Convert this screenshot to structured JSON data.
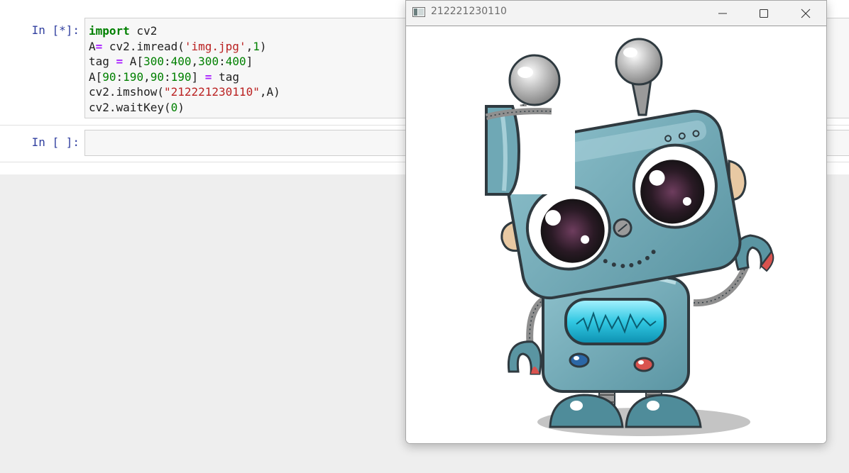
{
  "notebook": {
    "cells": [
      {
        "prompt": "In [*]:",
        "lines": [
          [
            {
              "t": "import",
              "c": "kw"
            },
            {
              "t": " cv2",
              "c": ""
            }
          ],
          [
            {
              "t": "A",
              "c": ""
            },
            {
              "t": "=",
              "c": "op"
            },
            {
              "t": " cv2.imread(",
              "c": ""
            },
            {
              "t": "'img.jpg'",
              "c": "str"
            },
            {
              "t": ",",
              "c": ""
            },
            {
              "t": "1",
              "c": "num"
            },
            {
              "t": ")",
              "c": ""
            }
          ],
          [
            {
              "t": "tag ",
              "c": ""
            },
            {
              "t": "=",
              "c": "op"
            },
            {
              "t": " A[",
              "c": ""
            },
            {
              "t": "300",
              "c": "num"
            },
            {
              "t": ":",
              "c": ""
            },
            {
              "t": "400",
              "c": "num"
            },
            {
              "t": ",",
              "c": ""
            },
            {
              "t": "300",
              "c": "num"
            },
            {
              "t": ":",
              "c": ""
            },
            {
              "t": "400",
              "c": "num"
            },
            {
              "t": "]",
              "c": ""
            }
          ],
          [
            {
              "t": "A[",
              "c": ""
            },
            {
              "t": "90",
              "c": "num"
            },
            {
              "t": ":",
              "c": ""
            },
            {
              "t": "190",
              "c": "num"
            },
            {
              "t": ",",
              "c": ""
            },
            {
              "t": "90",
              "c": "num"
            },
            {
              "t": ":",
              "c": ""
            },
            {
              "t": "190",
              "c": "num"
            },
            {
              "t": "] ",
              "c": ""
            },
            {
              "t": "=",
              "c": "op"
            },
            {
              "t": " tag",
              "c": ""
            }
          ],
          [
            {
              "t": "cv2.imshow(",
              "c": ""
            },
            {
              "t": "\"212221230110\"",
              "c": "str"
            },
            {
              "t": ",A)",
              "c": ""
            }
          ],
          [
            {
              "t": "cv2.waitKey(",
              "c": ""
            },
            {
              "t": "0",
              "c": "num"
            },
            {
              "t": ")",
              "c": ""
            }
          ]
        ]
      },
      {
        "prompt": "In [ ]:",
        "lines": []
      }
    ]
  },
  "window": {
    "title": "212221230110",
    "icon": "opencv-window-icon",
    "controls": [
      "minimize-icon",
      "maximize-icon",
      "close-icon"
    ],
    "image": "cartoon robot with a pasted square patch covering its left eye area"
  },
  "colors": {
    "prompt": "#303f9f",
    "keyword": "#008000",
    "operator": "#aa22ff",
    "string": "#ba2121",
    "number": "#008000",
    "robot_body": "#6fa8b5",
    "robot_outline": "#2f3a40"
  }
}
